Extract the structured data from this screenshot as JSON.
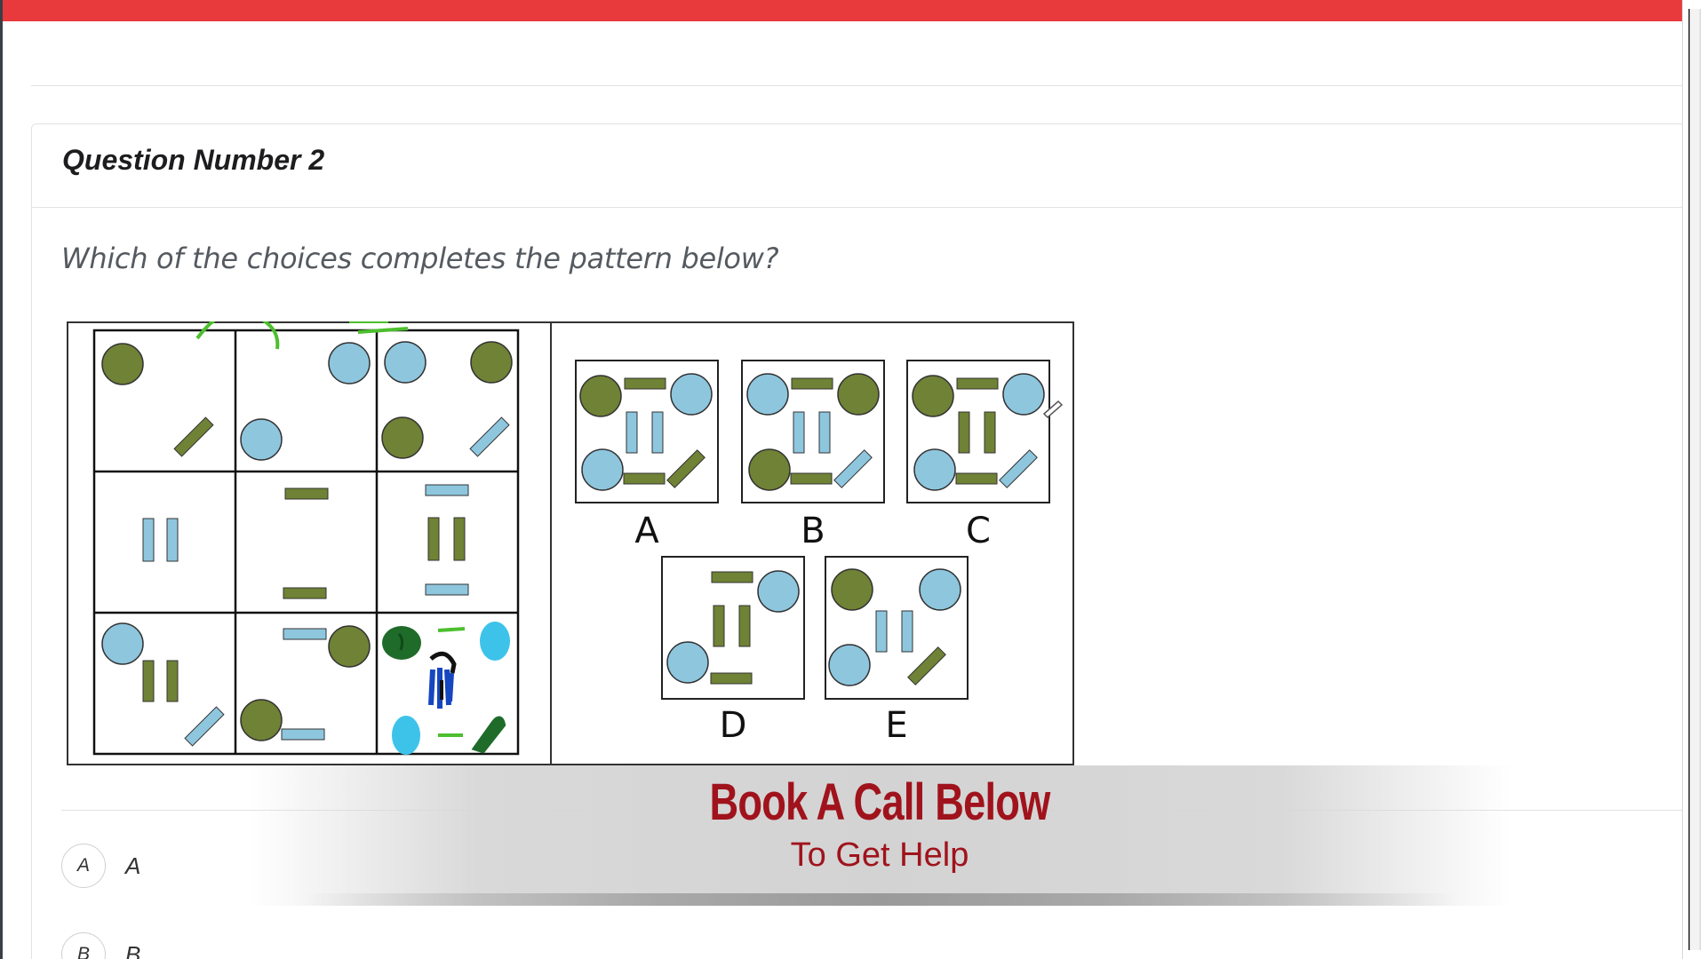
{
  "card": {
    "title": "Question Number 2"
  },
  "question": {
    "text": "Which of the choices completes the pattern below?"
  },
  "figure": {
    "choice_labels": [
      "A",
      "B",
      "C",
      "D",
      "E"
    ]
  },
  "options": [
    {
      "letter": "A",
      "label": "A"
    },
    {
      "letter": "B",
      "label": "B"
    }
  ],
  "banner": {
    "title": "Book A Call Below",
    "subtitle": "To Get Help"
  },
  "colors": {
    "top_bar": "#e8393c",
    "olive": "#6f8235",
    "light_blue": "#8ec6de",
    "banner_red": "#a0131c"
  }
}
